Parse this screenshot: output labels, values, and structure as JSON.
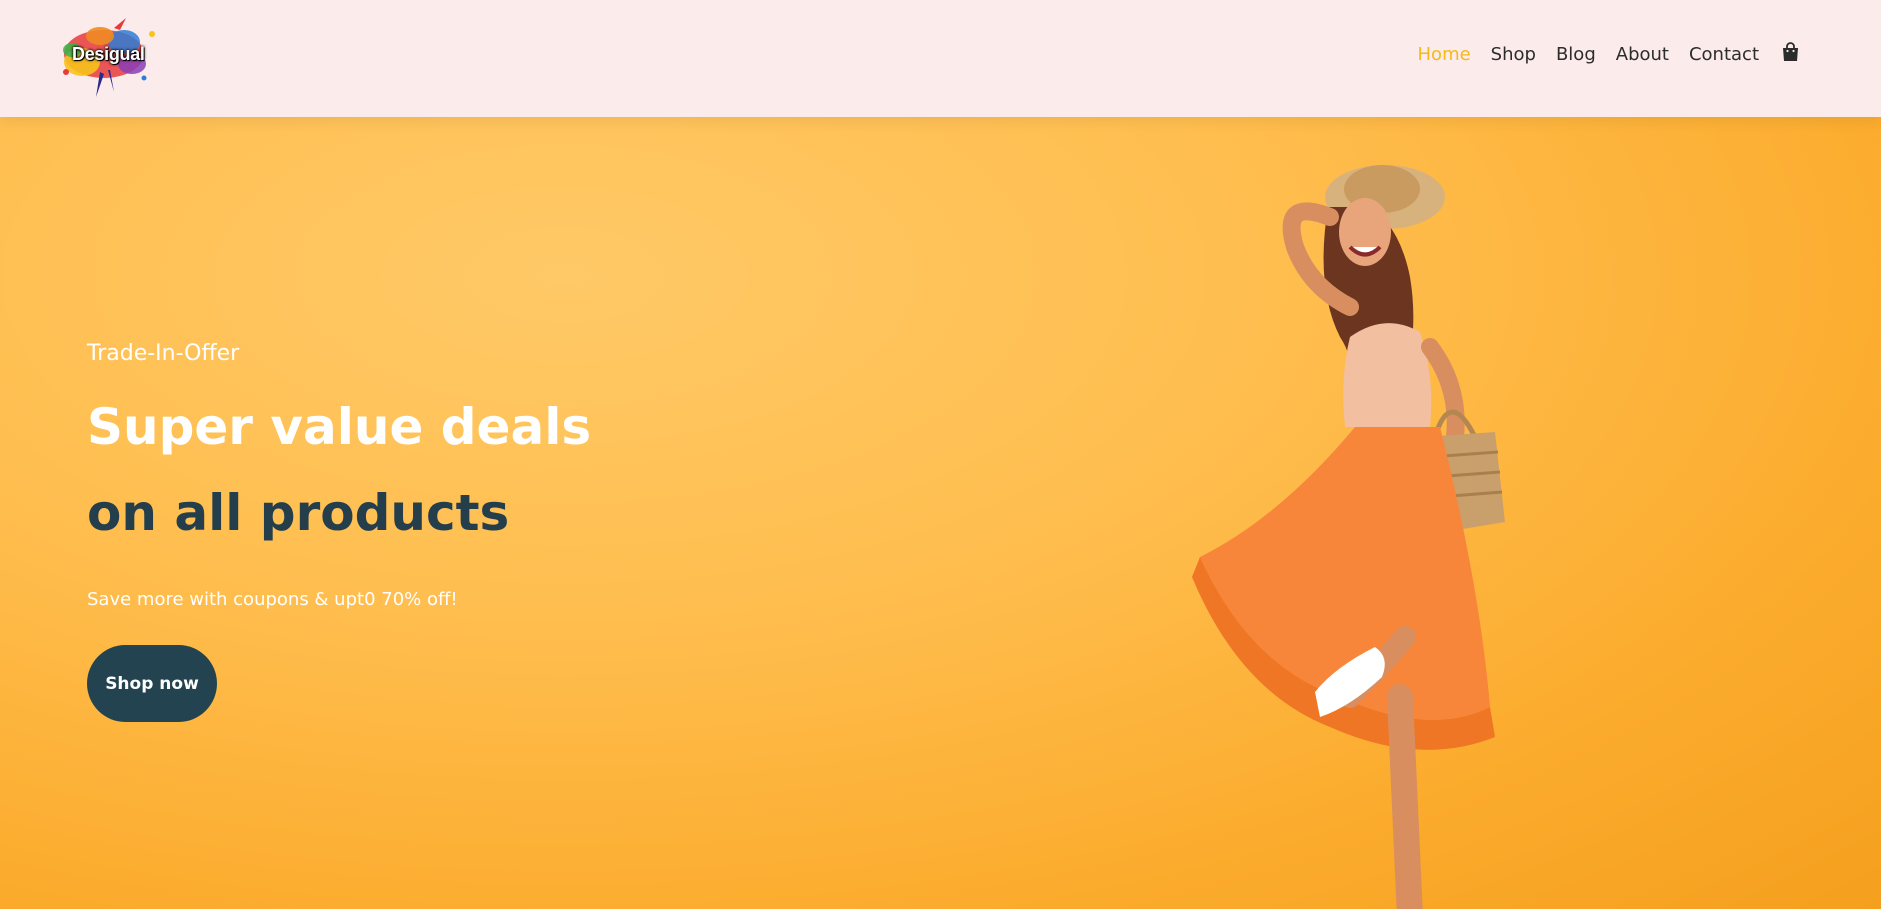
{
  "header": {
    "logo_text": "Desigual",
    "nav": [
      {
        "label": "Home",
        "active": true
      },
      {
        "label": "Shop",
        "active": false
      },
      {
        "label": "Blog",
        "active": false
      },
      {
        "label": "About",
        "active": false
      },
      {
        "label": "Contact",
        "active": false
      }
    ],
    "cart_icon": "shopping-bag-icon"
  },
  "hero": {
    "subtitle": "Trade-In-Offer",
    "headline_line1": "Super value deals",
    "headline_line2": "on all products",
    "description": "Save more with coupons & upt0 70% off!",
    "cta_label": "Shop now"
  },
  "colors": {
    "header_bg": "#fcebeb",
    "nav_active": "#f4ba1a",
    "nav_text": "#2c2c2c",
    "hero_bg": "#fbab2c",
    "headline_dark": "#243e4c",
    "button_bg": "#22434f"
  }
}
